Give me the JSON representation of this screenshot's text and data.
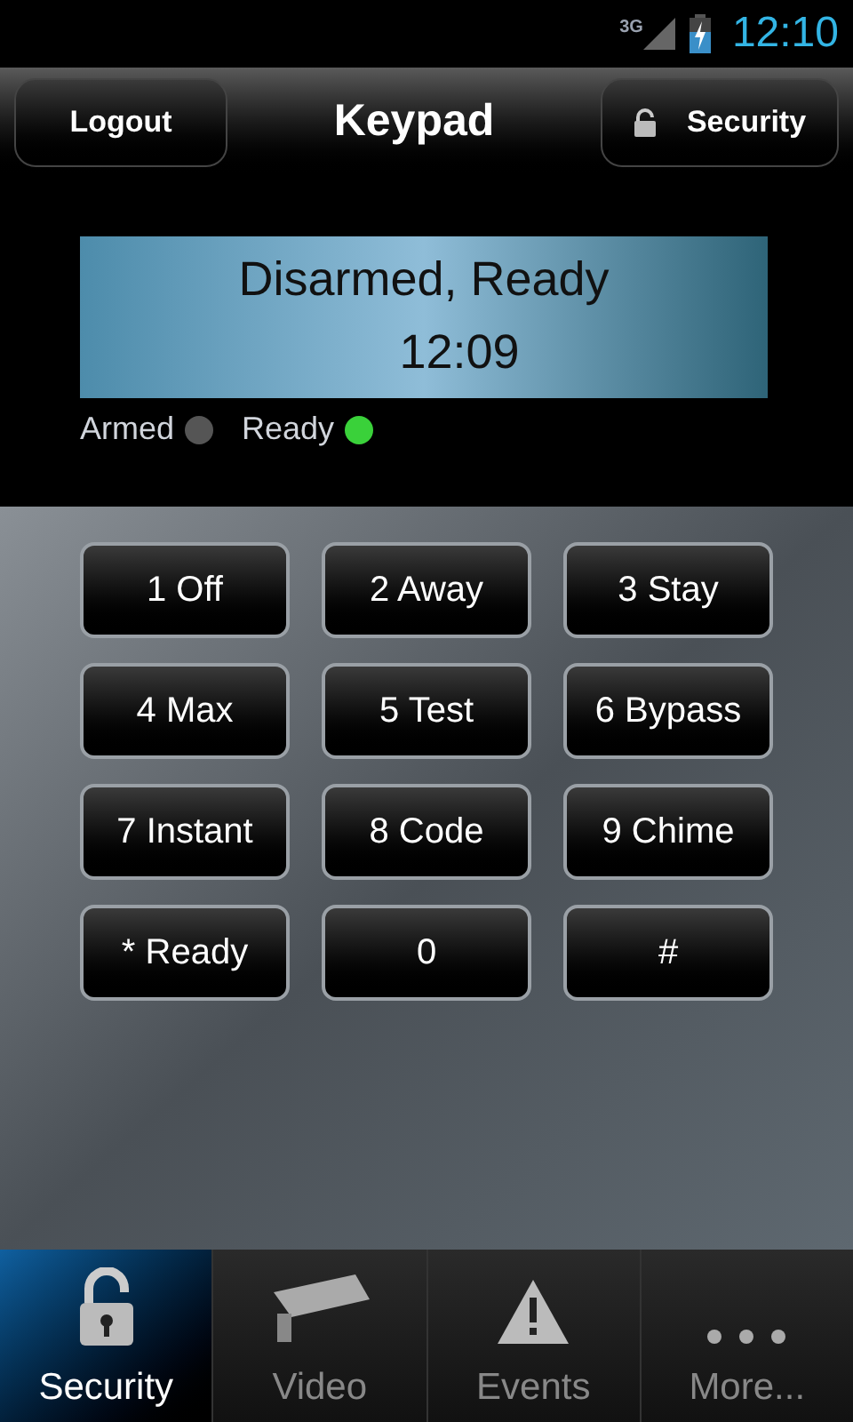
{
  "status_bar": {
    "network": "3G",
    "time": "12:10"
  },
  "header": {
    "left_button": "Logout",
    "title": "Keypad",
    "right_button": "Security"
  },
  "display": {
    "line_1": "Disarmed, Ready",
    "line_2": "12:09"
  },
  "indicators": [
    {
      "label": "Armed",
      "on": false
    },
    {
      "label": "Ready",
      "on": true
    }
  ],
  "keys": [
    "1 Off",
    "2 Away",
    "3 Stay",
    "4 Max",
    "5 Test",
    "6 Bypass",
    "7 Instant",
    "8 Code",
    "9 Chime",
    "* Ready",
    "0",
    "#"
  ],
  "tabs": [
    {
      "label": "Security",
      "kind": "lock",
      "selected": true
    },
    {
      "label": "Video",
      "kind": "camera",
      "selected": false
    },
    {
      "label": "Events",
      "kind": "warning",
      "selected": false
    },
    {
      "label": "More...",
      "kind": "more",
      "selected": false
    }
  ]
}
